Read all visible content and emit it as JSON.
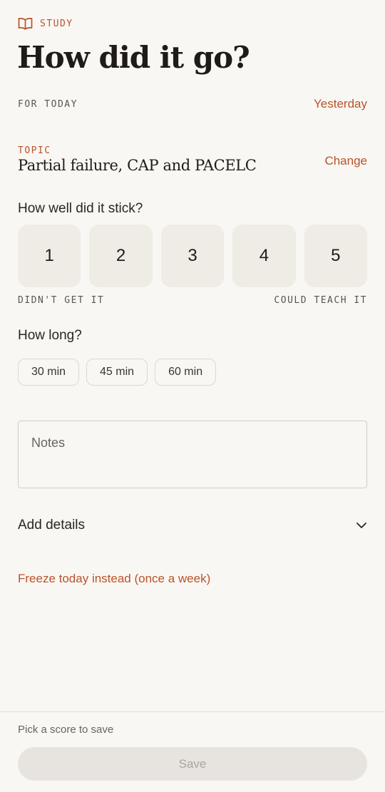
{
  "header": {
    "eyebrow": "STUDY",
    "eyebrow_icon": "book-icon",
    "title": "How did it go?"
  },
  "date": {
    "label": "FOR TODAY",
    "action": "Yesterday"
  },
  "topic": {
    "label": "TOPIC",
    "value": "Partial failure, CAP and PACELC",
    "action": "Change"
  },
  "rating": {
    "question": "How well did it stick?",
    "scores": [
      "1",
      "2",
      "3",
      "4",
      "5"
    ],
    "low_label": "DIDN'T GET IT",
    "high_label": "COULD TEACH IT"
  },
  "duration": {
    "question": "How long?",
    "options": [
      "30 min",
      "45 min",
      "60 min"
    ]
  },
  "notes": {
    "placeholder": "Notes"
  },
  "details": {
    "label": "Add details",
    "icon": "chevron-down-icon"
  },
  "freeze": {
    "label": "Freeze today instead (once a week)"
  },
  "footer": {
    "hint": "Pick a score to save",
    "save_label": "Save"
  },
  "colors": {
    "accent": "#b8532a",
    "background": "#f9f7f3",
    "tile": "#efebe5",
    "disabled": "#e7e4e0"
  }
}
